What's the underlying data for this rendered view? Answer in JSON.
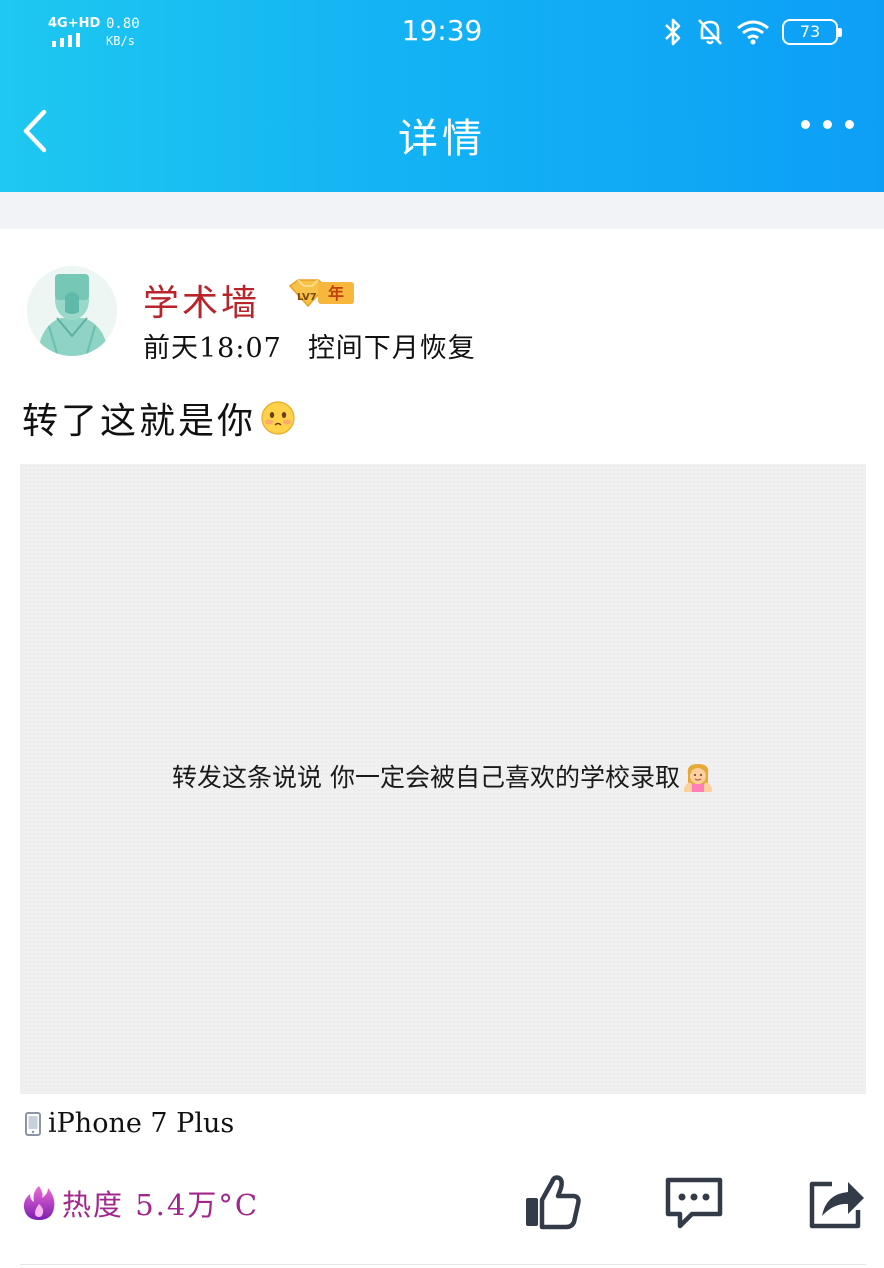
{
  "status_bar": {
    "network": "4G+HD",
    "speed_value": "0.80",
    "speed_unit": "KB/s",
    "time": "19:39",
    "battery": "73"
  },
  "nav": {
    "title": "详情",
    "back_icon": "chevron-left-icon",
    "more_icon": "more-dots-icon"
  },
  "post": {
    "author": "学术墙",
    "level_badge": "LV7",
    "year_badge": "年",
    "time": "前天18:07",
    "privacy": "控间下月恢复",
    "text": "转了这就是你",
    "image_caption": "转发这条说说 你一定会被自己喜欢的学校录取",
    "device": "iPhone 7 Plus"
  },
  "footer": {
    "heat_label": "热度 5.4万°C",
    "like_icon": "thumbs-up-icon",
    "comment_icon": "comment-icon",
    "share_icon": "share-icon"
  },
  "colors": {
    "header_start": "#1ec8f0",
    "header_end": "#0d9ff6",
    "username": "#b8242a",
    "heat": "#a0278b"
  }
}
